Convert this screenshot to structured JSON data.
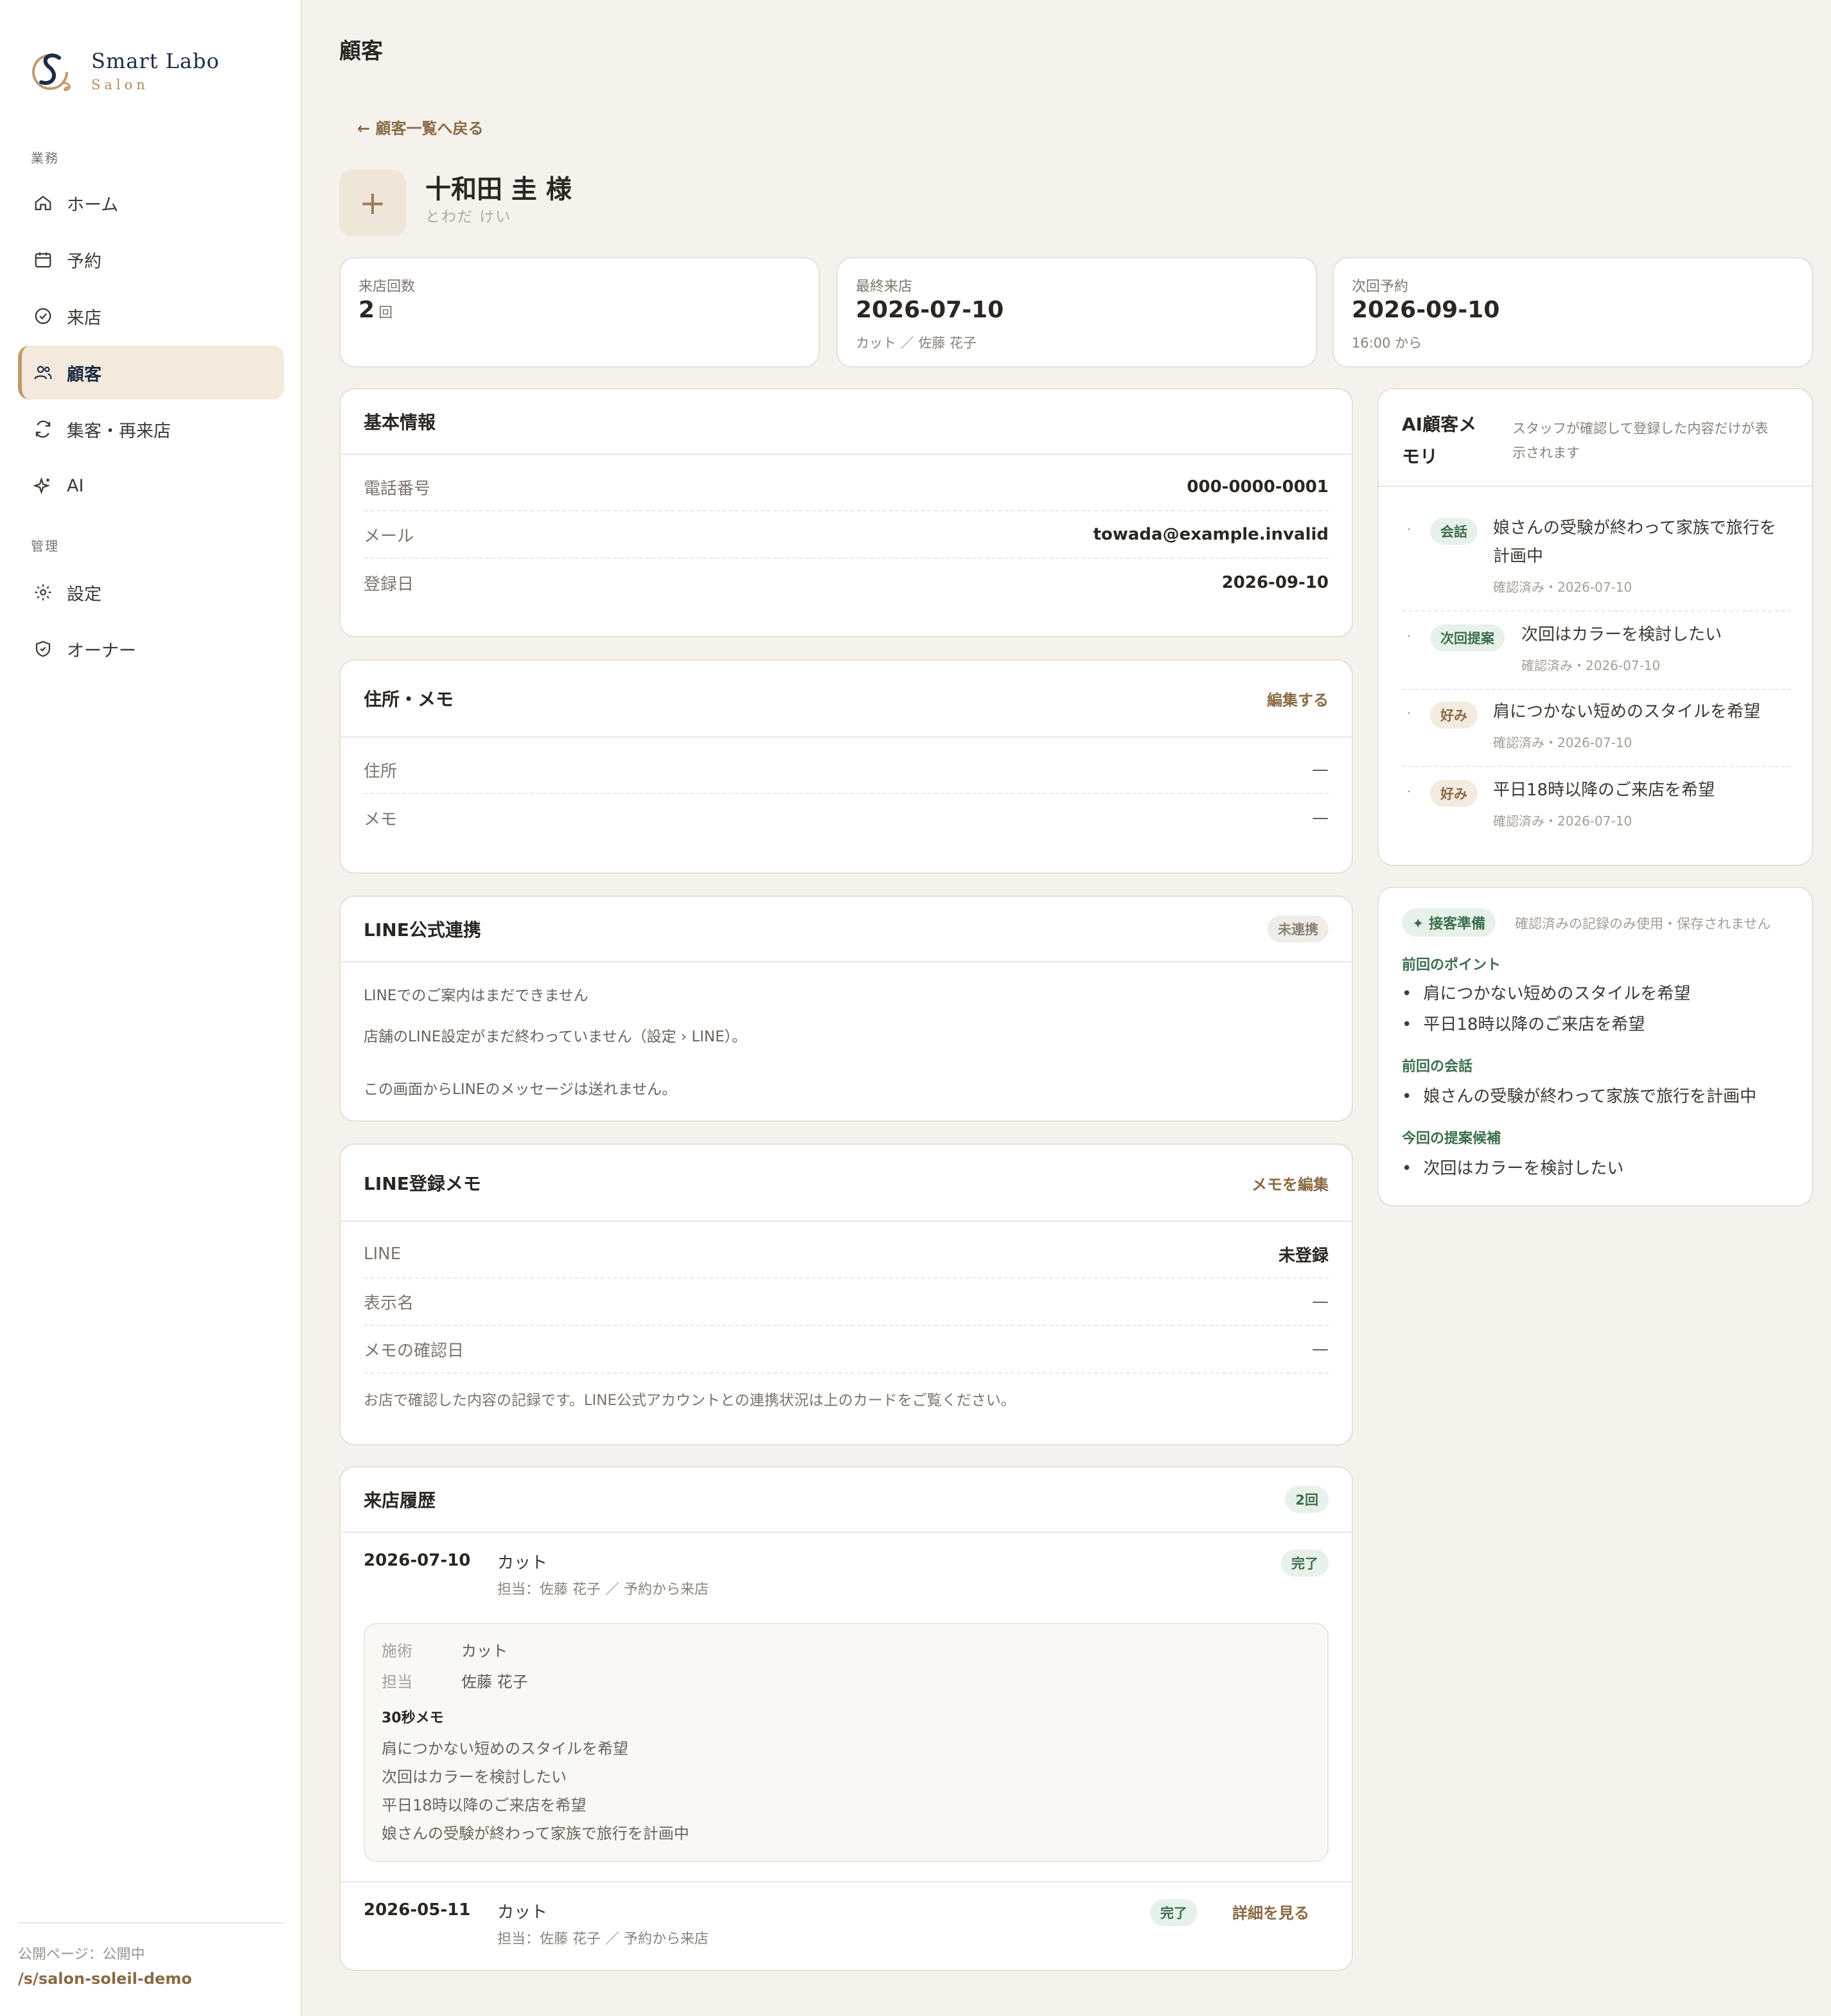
{
  "brand": {
    "name": "Smart Labo",
    "sub": "Salon"
  },
  "nav": {
    "group_work": "業務",
    "group_admin": "管理",
    "items": [
      {
        "label": "ホーム",
        "icon": "home-icon"
      },
      {
        "label": "予約",
        "icon": "calendar-icon"
      },
      {
        "label": "来店",
        "icon": "check-circle-icon"
      },
      {
        "label": "顧客",
        "icon": "users-icon"
      },
      {
        "label": "集客・再来店",
        "icon": "refresh-icon"
      },
      {
        "label": "AI",
        "icon": "sparkle-icon"
      },
      {
        "label": "設定",
        "icon": "gear-icon"
      },
      {
        "label": "オーナー",
        "icon": "shield-icon"
      }
    ],
    "active": "顧客"
  },
  "footer": {
    "status": "公開ページ：公開中",
    "url": "/s/salon-soleil-demo"
  },
  "page": {
    "title": "顧客",
    "back": "← 顧客一覧へ戻る"
  },
  "customer": {
    "avatar_glyph": "+",
    "name": "十和田 圭 様",
    "kana": "とわだ けい"
  },
  "stats": {
    "visits": {
      "label": "来店回数",
      "value": "2",
      "unit": "回"
    },
    "last": {
      "label": "最終来店",
      "value": "2026-07-10",
      "sub": "カット ／ 佐藤 花子"
    },
    "next": {
      "label": "次回予約",
      "value": "2026-09-10",
      "sub": "16:00 から"
    }
  },
  "basic": {
    "title": "基本情報",
    "rows": [
      {
        "k": "電話番号",
        "v": "000-0000-0001"
      },
      {
        "k": "メール",
        "v": "towada@example.invalid"
      },
      {
        "k": "登録日",
        "v": "2026-09-10"
      }
    ]
  },
  "address": {
    "title": "住所・メモ",
    "action": "編集する",
    "rows": [
      {
        "k": "住所",
        "v": "—"
      },
      {
        "k": "メモ",
        "v": "—"
      }
    ]
  },
  "line_link": {
    "title": "LINE公式連携",
    "badge": "未連携",
    "lines": [
      "LINEでのご案内はまだできません",
      "店舗のLINE設定がまだ終わっていません（設定 › LINE）。",
      "この画面からLINEのメッセージは送れません。"
    ]
  },
  "line_memo": {
    "title": "LINE登録メモ",
    "action": "メモを編集",
    "rows": [
      {
        "k": "LINE",
        "v": "未登録"
      },
      {
        "k": "表示名",
        "v": "—"
      },
      {
        "k": "メモの確認日",
        "v": "—"
      }
    ],
    "note": "お店で確認した内容の記録です。LINE公式アカウントとの連携状況は上のカードをご覧ください。"
  },
  "history": {
    "title": "来店履歴",
    "count": "2回",
    "visits": [
      {
        "date": "2026-07-10",
        "menu": "カット",
        "staff": "担当：佐藤 花子 ／ 予約から来店",
        "status": "完了",
        "detail": {
          "k1": "施術",
          "v1": "カット",
          "k2": "担当",
          "v2": "佐藤 花子",
          "memo_title": "30秒メモ",
          "memo": [
            "肩につかない短めのスタイルを希望",
            "次回はカラーを検討したい",
            "平日18時以降のご来店を希望",
            "娘さんの受験が終わって家族で旅行を計画中"
          ]
        }
      },
      {
        "date": "2026-05-11",
        "menu": "カット",
        "staff": "担当：佐藤 花子 ／ 予約から来店",
        "status": "完了",
        "action": "詳細を見る"
      }
    ]
  },
  "ai_memory": {
    "title_1": "AI顧客メ",
    "title_2": "モリ",
    "desc_1": "スタッフが確認して登録した内容だけが表",
    "desc_2": "示されます",
    "items": [
      {
        "tag": "会話",
        "text_1": "娘さんの受験が終わって家族で旅行を",
        "text_2": "計画中",
        "sub": "確認済み・2026-07-10"
      },
      {
        "tag": "次回提案",
        "text_1": "次回はカラーを検討したい",
        "sub": "確認済み・2026-07-10"
      },
      {
        "tag": "好み",
        "text_1": "肩につかない短めのスタイルを希望",
        "sub": "確認済み・2026-07-10"
      },
      {
        "tag": "好み",
        "text_1": "平日18時以降のご来店を希望",
        "sub": "確認済み・2026-07-10"
      }
    ]
  },
  "prep": {
    "badge": "✦ 接客準備",
    "note": "確認済みの記録のみ使用・保存されません",
    "sections": [
      {
        "title": "前回のポイント",
        "items": [
          "肩につかない短めのスタイルを希望",
          "平日18時以降のご来店を希望"
        ]
      },
      {
        "title": "前回の会話",
        "items": [
          "娘さんの受験が終わって家族で旅行を計画中"
        ]
      },
      {
        "title": "今回の提案候補",
        "items": [
          "次回はカラーを検討したい"
        ]
      }
    ]
  },
  "colors": {
    "accent": "#8a6a45",
    "navy": "#1d2b45",
    "green": "#3c6e4d",
    "bg": "#f5f2ed"
  }
}
